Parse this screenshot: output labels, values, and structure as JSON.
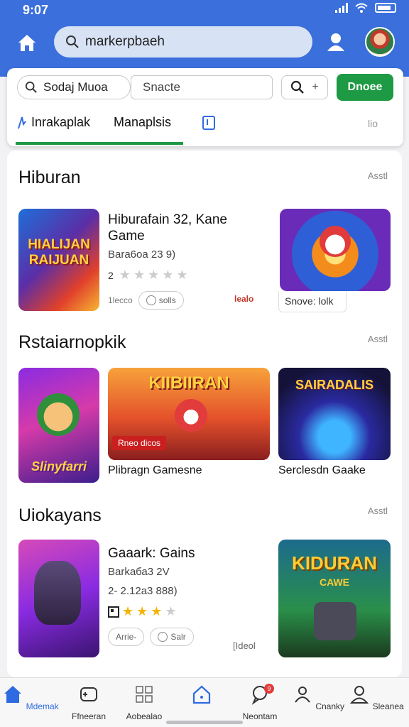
{
  "status": {
    "time": "9:07"
  },
  "search": {
    "value": "markerpbaeh"
  },
  "filters": {
    "pill_search": "Sodaj Muoa",
    "pill_text": "Snacte",
    "action_plus": "+",
    "button": "Dnoee"
  },
  "tabs": [
    {
      "label": "Inrakaplak"
    },
    {
      "label": "Manaplsis"
    },
    {
      "label": ""
    },
    {
      "label": "lio"
    }
  ],
  "sections": [
    {
      "title": "Hiburan",
      "more": "Asstl"
    },
    {
      "title": "Rstaiarnopkik",
      "more": "Asstl"
    },
    {
      "title": "Uiokayans",
      "more": "Asstl"
    }
  ],
  "featured1": {
    "thumb_text": "HIALIJAN RAIJUAN",
    "name": "Hiburafain 32, Kane Game",
    "sub": "Bara6oa 23 9)",
    "rating_lead": "2",
    "rating": 0,
    "chip1": "1lecco",
    "chip2": "solls",
    "red": "lealo",
    "side_caption": "Snove: lolk"
  },
  "games": [
    {
      "thumb_text": "KIIBIIRAN",
      "tag": "Rneo dicos",
      "name": "Plibragn Gamesne"
    },
    {
      "thumb_text": "SAIRADALIS",
      "name": "Serclesdn Gaake"
    },
    {
      "thumb_text": "Slinyfarri"
    }
  ],
  "featured2": {
    "name": "Gaaark: Gains",
    "sub": "Barkaба3 2V",
    "price": "2- 2.12а3 888)",
    "rating": 3,
    "chip1": "Arrie-",
    "chip2": "Salr",
    "grey": "[Ideol",
    "side_thumb": "KIDURAN",
    "side_sub": "CAWE"
  },
  "nav": [
    {
      "label": "Mdemak"
    },
    {
      "label": "Ffneeran"
    },
    {
      "label": "Aobealao"
    },
    {
      "label": ""
    },
    {
      "label": "Neontam",
      "badge": "9"
    },
    {
      "label": "Cnanky"
    },
    {
      "label": "Sleanea"
    }
  ],
  "colors": {
    "header": "#3a6fdc",
    "accent_green": "#1e9a44",
    "active_nav": "#2f6be0",
    "star": "#f5b400"
  }
}
